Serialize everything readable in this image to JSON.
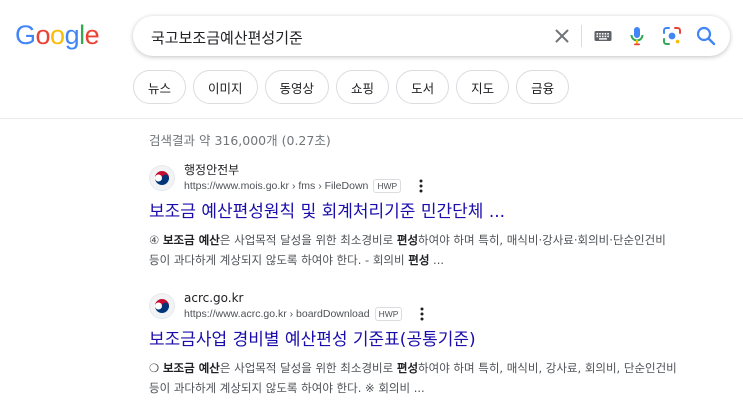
{
  "logo": {
    "letters": [
      "G",
      "o",
      "o",
      "g",
      "l",
      "e"
    ],
    "colors": [
      "#4285F4",
      "#EA4335",
      "#FBBC05",
      "#4285F4",
      "#34A853",
      "#EA4335"
    ]
  },
  "search": {
    "query": "국고보조금예산편성기준",
    "icons": [
      "clear-icon",
      "keyboard-icon",
      "mic-icon",
      "lens-icon",
      "search-icon"
    ]
  },
  "chips": [
    "뉴스",
    "이미지",
    "동영상",
    "쇼핑",
    "도서",
    "지도",
    "금융"
  ],
  "stats": "검색결과 약 316,000개 (0.27초)",
  "results": [
    {
      "site_name": "행정안전부",
      "url": "https://www.mois.go.kr › fms › FileDown",
      "filetype": "HWP",
      "title": "보조금 예산편성원칙 및 회계처리기준 민간단체 ...",
      "snippet_line1": [
        {
          "t": "④ ",
          "b": false
        },
        {
          "t": "보조금 예산",
          "b": true
        },
        {
          "t": "은 사업목적 달성을 위한 최소경비로 ",
          "b": false
        },
        {
          "t": "편성",
          "b": true
        },
        {
          "t": "하여야 하며 특히, 매식비·강사료·회의비·단순인건비",
          "b": false
        }
      ],
      "snippet_line2": [
        {
          "t": "등이 과다하게 계상되지 않도록 하여야 한다. - 회의비 ",
          "b": false
        },
        {
          "t": "편성",
          "b": true
        },
        {
          "t": " ...",
          "b": false
        }
      ]
    },
    {
      "site_name": "acrc.go.kr",
      "url": "https://www.acrc.go.kr › boardDownload",
      "filetype": "HWP",
      "title": "보조금사업 경비별 예산편성 기준표(공통기준)",
      "snippet_line1": [
        {
          "t": "❍ ",
          "b": false
        },
        {
          "t": "보조금 예산",
          "b": true
        },
        {
          "t": "은 사업목적 달성을 위한 최소경비로 ",
          "b": false
        },
        {
          "t": "편성",
          "b": true
        },
        {
          "t": "하여야 하며 특히, 매식비, 강사료, 회의비, 단순인건비",
          "b": false
        }
      ],
      "snippet_line2": [
        {
          "t": "등이 과다하게 계상되지 않도록 하여야 한다. ※ 회의비 ...",
          "b": false
        }
      ]
    }
  ]
}
